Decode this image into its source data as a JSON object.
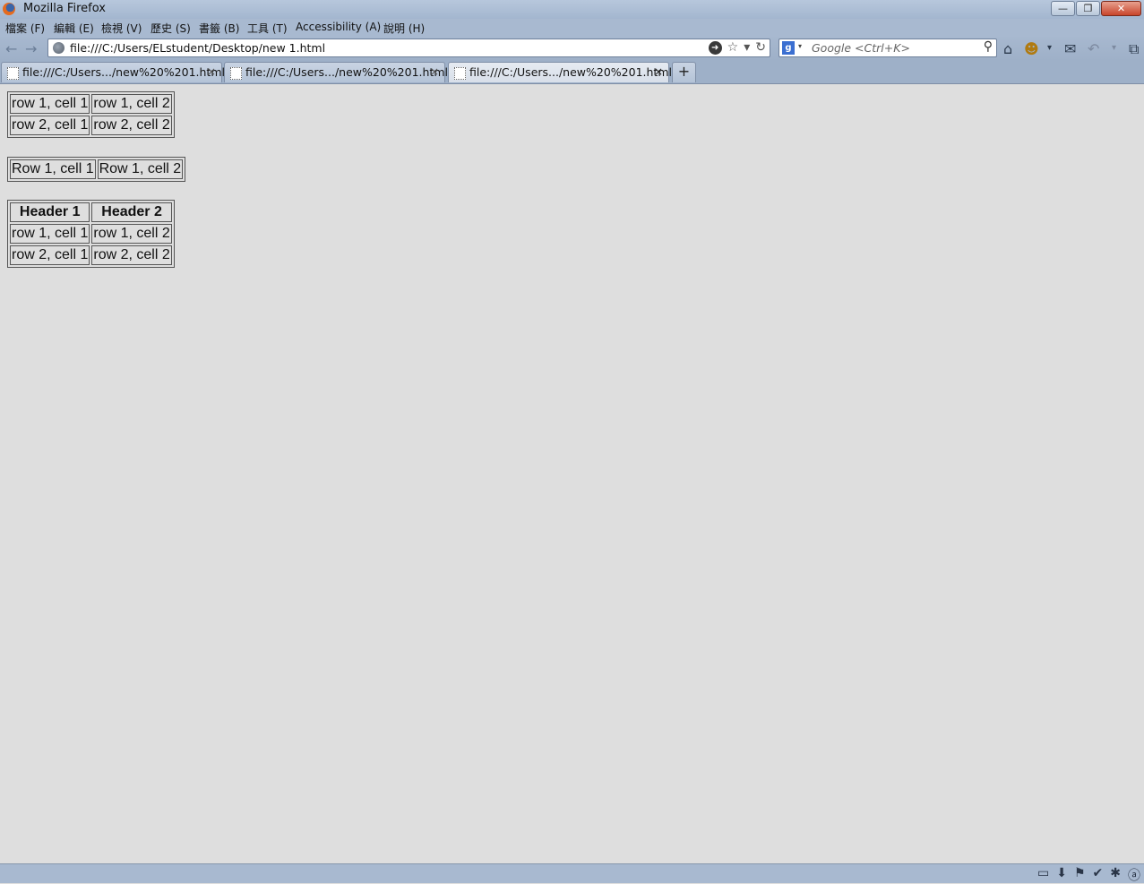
{
  "window": {
    "title": "Mozilla Firefox",
    "minimize_symbol": "—",
    "restore_symbol": "❐",
    "close_symbol": "✕"
  },
  "menu": [
    "檔案 (F)",
    "編輯 (E)",
    "檢視 (V)",
    "歷史 (S)",
    "書籤 (B)",
    "工具 (T)",
    "Accessibility (A)",
    "說明 (H)"
  ],
  "nav": {
    "back_symbol": "←",
    "forward_symbol": "→",
    "url": "file:///C:/Users/ELstudent/Desktop/new  1.html",
    "go_symbol": "➜",
    "bookmark_star_symbol": "☆",
    "dropdown_symbol": "▾",
    "reload_symbol": "↻",
    "search_engine_letter": "g",
    "search_engine_caret": "▾",
    "search_placeholder": "Google <Ctrl+K>",
    "search_symbol": "⚲",
    "toolbar_symbols": [
      "⌂",
      "☻",
      "▾",
      "✉",
      "↶",
      "▾",
      "⧉"
    ]
  },
  "tabs": [
    {
      "label": "file:///C:/Users.../new%20%201.html",
      "close": "×"
    },
    {
      "label": "file:///C:/Users.../new%20%201.html",
      "close": "×"
    },
    {
      "label": "file:///C:/Users.../new%20%201.html",
      "close": "×"
    }
  ],
  "new_tab_symbol": "+",
  "tables": {
    "table1": {
      "rows": [
        [
          "row 1, cell 1",
          "row 1, cell 2"
        ],
        [
          "row 2, cell 1",
          "row 2, cell 2"
        ]
      ]
    },
    "table2": {
      "rows": [
        [
          "Row 1, cell 1",
          "Row 1, cell 2"
        ]
      ]
    },
    "table3": {
      "headers": [
        "Header 1",
        "Header 2"
      ],
      "rows": [
        [
          "row 1, cell 1",
          "row 1, cell 2"
        ],
        [
          "row 2, cell 1",
          "row 2, cell 2"
        ]
      ]
    }
  },
  "status_symbols": [
    "▭",
    "⬇",
    "⚑",
    "✔",
    "✱",
    "ⓐ"
  ],
  "colors": {
    "chrome": "#a8b9d0",
    "content_bg": "#dedede",
    "close_button": "#c8452b"
  }
}
